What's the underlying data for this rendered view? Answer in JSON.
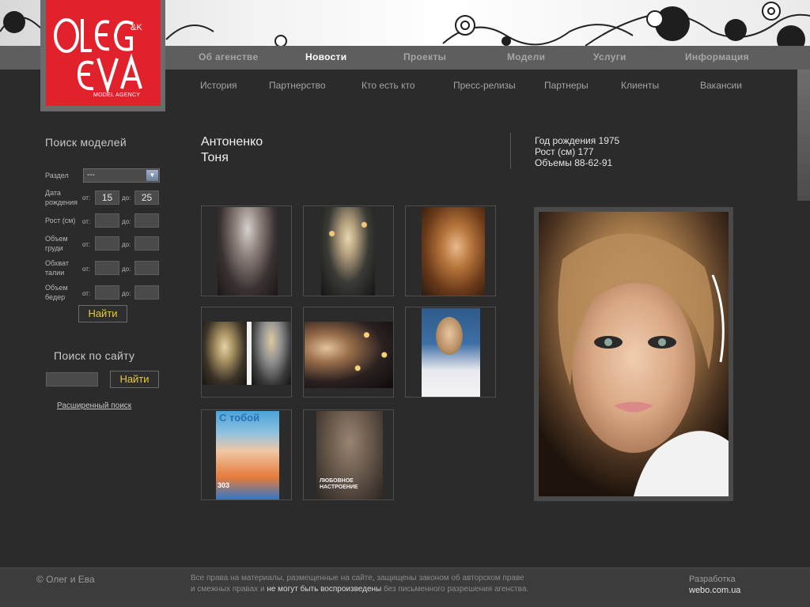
{
  "logo": {
    "text": "OLEG EVA",
    "suffix": "&K",
    "agency": "MODEL AGENCY"
  },
  "nav": {
    "main": [
      "Об агенстве",
      "Новости",
      "Проекты",
      "Модели",
      "Услуги",
      "Информация"
    ],
    "active_index": 1,
    "sub": [
      "История",
      "Партнерство",
      "Кто есть кто",
      "Пресс-релизы",
      "Партнеры",
      "Клиенты",
      "Вакансии"
    ]
  },
  "model_search": {
    "title": "Поиск моделей",
    "section_label": "Раздел",
    "section_value": "---",
    "birth_label": "Дата рождения",
    "birth_line1": "Дата",
    "birth_line2": "рождения",
    "height_label": "Рост (см)",
    "chest_line1": "Объем",
    "chest_line2": "груди",
    "waist_line1": "Обхват",
    "waist_line2": "талии",
    "hips_line1": "Объем",
    "hips_line2": "бедер",
    "from": "от:",
    "to": "до:",
    "birth_from": "15",
    "birth_to": "25",
    "button": "Найти"
  },
  "site_search": {
    "title": "Поиск по сайту",
    "button": "Найти",
    "advanced": "Расширенный поиск"
  },
  "model": {
    "name_line1": "Антоненко",
    "name_line2": "Тоня",
    "birth_year": "Год рождения 1975",
    "height": "Рост (см) 177",
    "measurements": "Объемы 88-62-91"
  },
  "gallery": {
    "thumbs": [
      "photo-1",
      "photo-2",
      "photo-3",
      "photo-4",
      "photo-5",
      "photo-6",
      "photo-7",
      "photo-8"
    ],
    "magazine_1": "С тобой",
    "magazine_1_num": "303",
    "magazine_2": "ЛЮБОВНОЕ НАСТРОЕНИЕ"
  },
  "footer": {
    "copyright": "© Олег и Ева",
    "legal_1": "Все права на материалы, размещенные на сайте, защищены законом об авторском праве",
    "legal_2a": "и смежных правах и ",
    "legal_2b": "не могут быть воспроизведены",
    "legal_2c": " без письменного разрешения агенства.",
    "dev_label": "Разработка",
    "dev_site": "webo.com.ua"
  },
  "colors": {
    "background": "#2b2b2b",
    "logo_red": "#e1222d",
    "button_text": "#e7c93a"
  }
}
